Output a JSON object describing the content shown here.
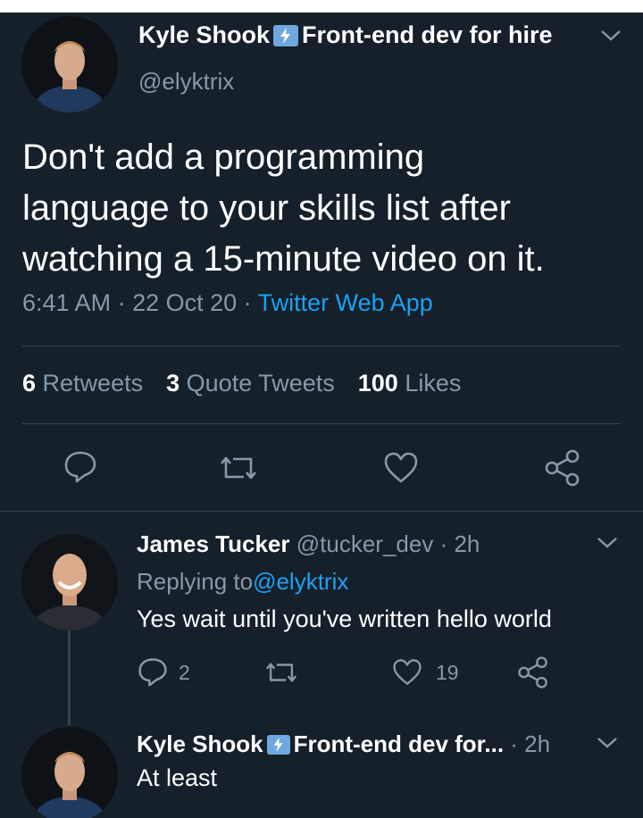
{
  "tweet": {
    "author_name": "Kyle Shook",
    "author_bio_tag": "Front-end dev for hire",
    "author_handle": "@elyktrix",
    "text_line1": "Don't add a programming",
    "text_line2": "language to your skills list after",
    "text_line3": "watching a 15-minute video on it.",
    "time": "6:41 AM",
    "sep1": " · ",
    "date": "22 Oct 20",
    "sep2": " · ",
    "source": "Twitter Web App",
    "retweets_count": "6",
    "retweets_label": "Retweets",
    "quotes_count": "3",
    "quotes_label": "Quote Tweets",
    "likes_count": "100",
    "likes_label": "Likes"
  },
  "reply1": {
    "name": "James Tucker",
    "handle": "@tucker_dev",
    "time": "· 2h",
    "replying_prefix": "Replying to ",
    "replying_to": "@elyktrix",
    "text": "Yes wait until you've written hello world",
    "reply_count": "2",
    "like_count": "19"
  },
  "reply2": {
    "name": "Kyle Shook",
    "bio_tag": "Front-end dev for...",
    "time": "· 2h",
    "text": "At least"
  },
  "icons": {
    "reply": "reply-icon",
    "retweet": "retweet-icon",
    "like": "heart-icon",
    "share": "share-icon",
    "more": "chevron-down-icon",
    "badge": "lightning-icon"
  },
  "colors": {
    "background": "#15202b",
    "muted": "#8899a6",
    "link": "#1da1f2",
    "divider": "#38444d"
  }
}
